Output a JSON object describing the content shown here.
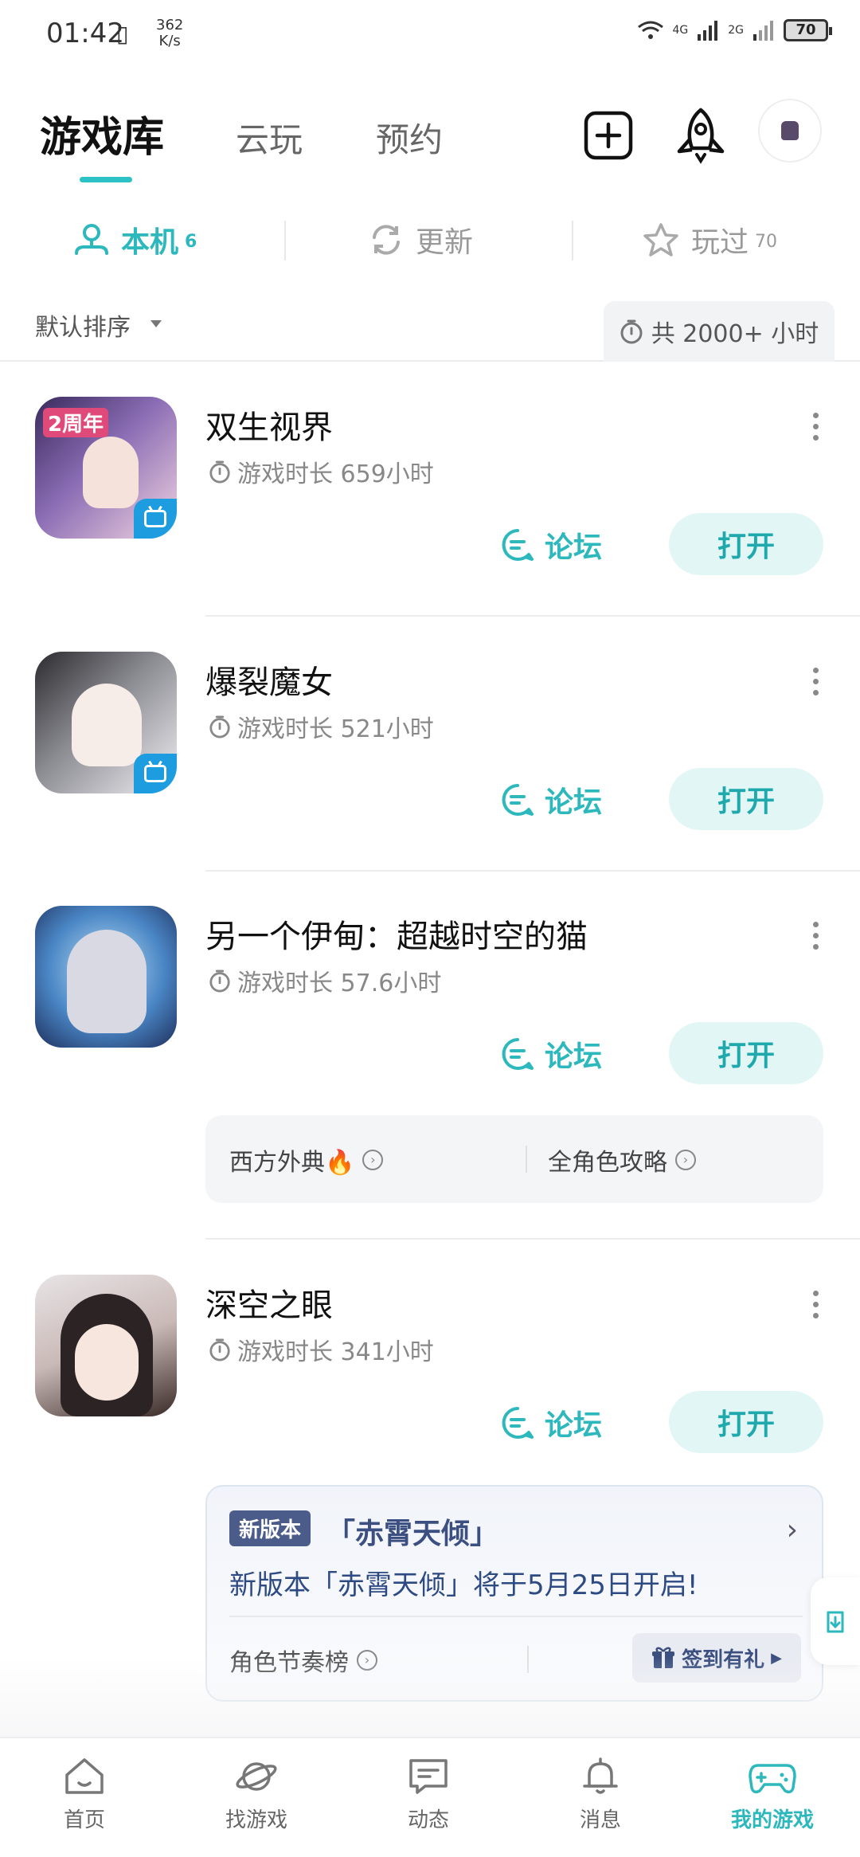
{
  "status_bar": {
    "time": "01:42",
    "speed_value": "362",
    "speed_unit": "K/s",
    "net1": "4G",
    "net2": "2G",
    "battery": "70"
  },
  "top_tabs": {
    "library": "游戏库",
    "cloud": "云玩",
    "reserve": "预约"
  },
  "sub_tabs": [
    {
      "label": "本机",
      "count": "6"
    },
    {
      "label": "更新",
      "count": ""
    },
    {
      "label": "玩过",
      "count": "70"
    }
  ],
  "sort": {
    "label": "默认排序",
    "total_hours": "共 2000+ 小时"
  },
  "games": [
    {
      "name": "双生视界",
      "time": "游戏时长 659小时",
      "forum": "论坛",
      "open": "打开",
      "icon_badge": "2周年"
    },
    {
      "name": "爆裂魔女",
      "time": "游戏时长 521小时",
      "forum": "论坛",
      "open": "打开"
    },
    {
      "name": "另一个伊甸：超越时空的猫",
      "time": "游戏时长 57.6小时",
      "forum": "论坛",
      "open": "打开"
    },
    {
      "name": "深空之眼",
      "time": "游戏时长 341小时",
      "forum": "论坛",
      "open": "打开"
    }
  ],
  "eden_tips": {
    "left": "西方外典🔥",
    "right": "全角色攻略"
  },
  "news": {
    "tag": "新版本",
    "title": "「赤霄天倾」",
    "text": "新版本「赤霄天倾」将于5月25日开启!",
    "link": "角色节奏榜",
    "checkin": "签到有礼"
  },
  "bottom_nav": [
    {
      "label": "首页",
      "icon": "home-icon"
    },
    {
      "label": "找游戏",
      "icon": "planet-icon"
    },
    {
      "label": "动态",
      "icon": "chat-icon"
    },
    {
      "label": "消息",
      "icon": "bell-icon"
    },
    {
      "label": "我的游戏",
      "icon": "gamepad-icon"
    }
  ],
  "colors": {
    "accent": "#2cb8bc",
    "open_bg": "#e3f6f6",
    "news_text": "#2d4a83"
  }
}
